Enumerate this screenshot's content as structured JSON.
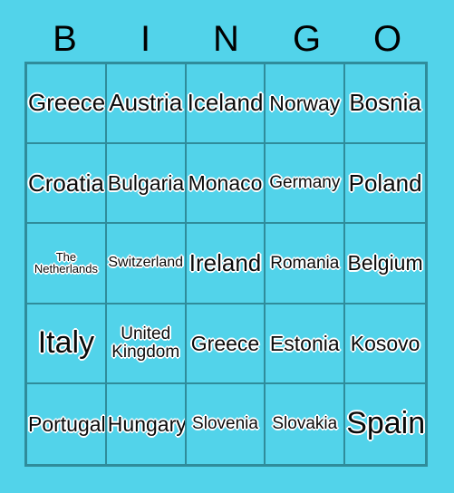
{
  "card": {
    "title_letters": [
      "B",
      "I",
      "N",
      "G",
      "O"
    ],
    "colors": {
      "background": "#52d3ea",
      "grid_line": "#2f8c9b",
      "text": "#0a0a0a",
      "text_outline": "#ffffff"
    },
    "grid": {
      "rows": 5,
      "columns": 5,
      "cells": [
        [
          {
            "label": "Greece",
            "size": "lg"
          },
          {
            "label": "Austria",
            "size": "lg"
          },
          {
            "label": "Iceland",
            "size": "lg"
          },
          {
            "label": "Norway",
            "size": "md"
          },
          {
            "label": "Bosnia",
            "size": "lg"
          }
        ],
        [
          {
            "label": "Croatia",
            "size": "lg"
          },
          {
            "label": "Bulgaria",
            "size": "md"
          },
          {
            "label": "Monaco",
            "size": "md"
          },
          {
            "label": "Germany",
            "size": "sm"
          },
          {
            "label": "Poland",
            "size": "lg"
          }
        ],
        [
          {
            "label": "The\nNetherlands",
            "size": "xxs"
          },
          {
            "label": "Switzerland",
            "size": "xs"
          },
          {
            "label": "Ireland",
            "size": "lg"
          },
          {
            "label": "Romania",
            "size": "sm"
          },
          {
            "label": "Belgium",
            "size": "md"
          }
        ],
        [
          {
            "label": "Italy",
            "size": "xl"
          },
          {
            "label": "United\nKingdom",
            "size": "sm"
          },
          {
            "label": "Greece",
            "size": "md"
          },
          {
            "label": "Estonia",
            "size": "md"
          },
          {
            "label": "Kosovo",
            "size": "md"
          }
        ],
        [
          {
            "label": "Portugal",
            "size": "md"
          },
          {
            "label": "Hungary",
            "size": "md"
          },
          {
            "label": "Slovenia",
            "size": "sm"
          },
          {
            "label": "Slovakia",
            "size": "sm"
          },
          {
            "label": "Spain",
            "size": "xl"
          }
        ]
      ]
    }
  }
}
